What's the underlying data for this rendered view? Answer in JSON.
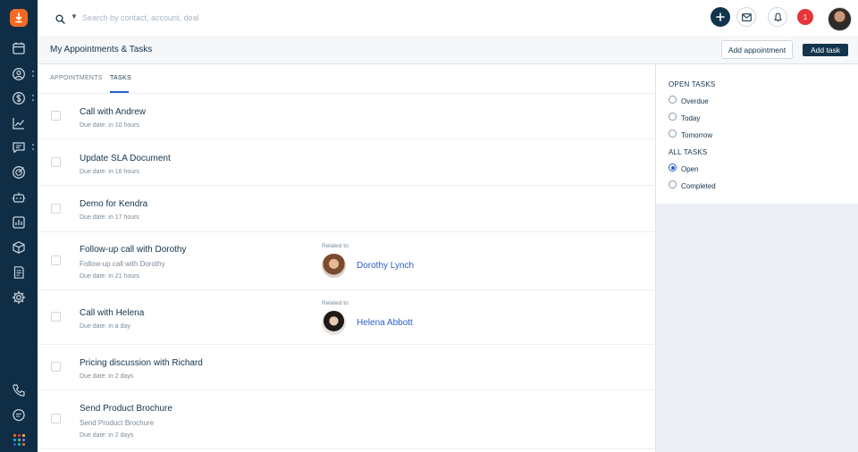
{
  "search": {
    "placeholder": "Search by contact, account, deal"
  },
  "notifications": {
    "count": "1"
  },
  "header": {
    "title": "My Appointments & Tasks",
    "add_appointment_label": "Add appointment",
    "add_task_label": "Add task"
  },
  "tabs": [
    {
      "label": "APPOINTMENTS",
      "active": false
    },
    {
      "label": "TASKS",
      "active": true
    }
  ],
  "tasks": [
    {
      "title": "Call with Andrew",
      "subtitle": "",
      "due": "Due date: in 10 hours",
      "related_label": "",
      "related_name": ""
    },
    {
      "title": "Update SLA Document",
      "subtitle": "",
      "due": "Due date: in 16 hours",
      "related_label": "",
      "related_name": ""
    },
    {
      "title": "Demo for Kendra",
      "subtitle": "",
      "due": "Due date: in 17 hours",
      "related_label": "",
      "related_name": ""
    },
    {
      "title": "Follow-up call with Dorothy",
      "subtitle": "Follow-up call with Dorothy",
      "due": "Due date: in 21 hours",
      "related_label": "Related to:",
      "related_name": "Dorothy Lynch"
    },
    {
      "title": "Call with Helena",
      "subtitle": "",
      "due": "Due date: in a day",
      "related_label": "Related to:",
      "related_name": "Helena Abbott"
    },
    {
      "title": "Pricing discussion with Richard",
      "subtitle": "",
      "due": "Due date: in 2 days",
      "related_label": "",
      "related_name": ""
    },
    {
      "title": "Send Product Brochure",
      "subtitle": "Send Product Brochure",
      "due": "Due date: in 2 days",
      "related_label": "",
      "related_name": ""
    }
  ],
  "filters": {
    "open_heading": "OPEN TASKS",
    "open_options": [
      "Overdue",
      "Today",
      "Tomorrow"
    ],
    "all_heading": "ALL TASKS",
    "all_options": [
      "Open",
      "Completed"
    ],
    "selected": "Open"
  },
  "colors": {
    "sidebar_bg": "#0f2e46",
    "primary": "#12344d",
    "link": "#2c5cc5",
    "brand_orange": "#f36a24",
    "badge_red": "#e43538"
  },
  "sidebar": {
    "icons": [
      "calendar-icon",
      "contacts-icon",
      "dollar-icon",
      "reports-chart-icon",
      "chat-icon",
      "target-icon",
      "bot-icon",
      "analytics-icon",
      "products-box-icon",
      "documents-icon",
      "settings-gear-icon",
      "phone-icon",
      "messages-icon",
      "apps-grid-icon"
    ]
  }
}
